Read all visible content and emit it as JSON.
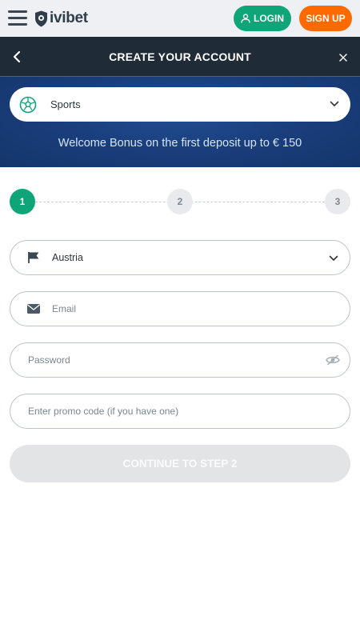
{
  "topbar": {
    "logo_text": "ivibet",
    "login_label": "LOGIN",
    "signup_label": "SIGN UP"
  },
  "header": {
    "title": "CREATE YOUR ACCOUNT"
  },
  "banner": {
    "sport_selected": "Sports",
    "bonus_text": "Welcome Bonus on the first deposit up to € 150"
  },
  "stepper": {
    "steps": [
      "1",
      "2",
      "3"
    ],
    "current": 1
  },
  "form": {
    "country_value": "Austria",
    "email_placeholder": "Email",
    "password_placeholder": "Password",
    "promo_placeholder": "Enter promo code (if you have one)",
    "continue_label": "CONTINUE TO STEP 2"
  },
  "colors": {
    "accent_green": "#0fa579",
    "accent_orange": "#ff6a00",
    "header_dark": "#1f2b36",
    "banner_blue": "#1a3f7d"
  }
}
